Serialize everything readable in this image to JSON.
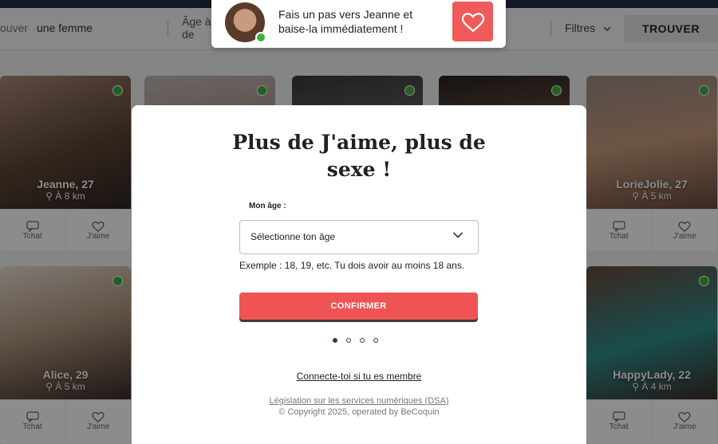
{
  "search": {
    "looking_label": "ouver",
    "looking_value": "une femme",
    "age_label_line1": "Âge à",
    "age_label_line2": "de",
    "filters_label": "Filtres",
    "search_button": "TROUVER"
  },
  "profiles": [
    {
      "name": "Jeanne, 27",
      "distance": "À 8 km",
      "chat": "Tchat",
      "like": "J'aime"
    },
    {
      "name": "LorieJolie, 27",
      "distance": "À 5 km",
      "chat": "Tchat",
      "like": "J'aime"
    },
    {
      "name": "Alice, 29",
      "distance": "À 5 km",
      "chat": "Tchat",
      "like": "J'aime"
    },
    {
      "name": "HappyLady, 22",
      "distance": "À 4 km",
      "chat": "Tchat",
      "like": "J'aime"
    }
  ],
  "notification": {
    "text": "Fais un pas vers Jeanne et baise-la immédiatement !"
  },
  "modal": {
    "title": "Plus de J'aime, plus de sexe !",
    "age_label": "Mon âge :",
    "select_value": "Sélectionne ton âge",
    "hint": "Exemple : 18, 19, etc. Tu dois avoir au moins 18 ans.",
    "confirm": "CONFIRMER",
    "steps_total": 4,
    "step_current": 1,
    "login_link": "Connecte-toi si tu es membre",
    "legal_link": "Législation sur les services numériques (DSA)",
    "copyright": "© Copyright 2025, operated by BeCoquin"
  },
  "colors": {
    "accent": "#ef5353",
    "online": "#3fae3f",
    "navy": "#1c2c44"
  }
}
